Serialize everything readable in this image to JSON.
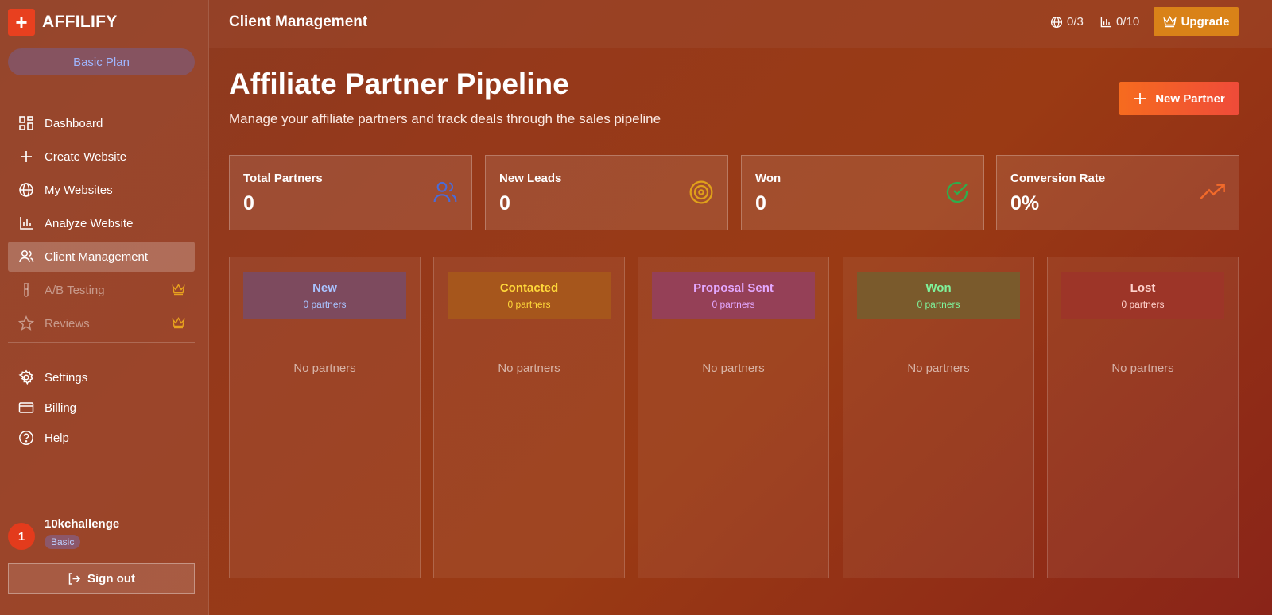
{
  "app": {
    "logo_glyph": "+",
    "name": "AFFILIFY",
    "plan_pill": "Basic Plan"
  },
  "sidebar": {
    "items": [
      {
        "label": "Dashboard",
        "icon": "grid-icon"
      },
      {
        "label": "Create Website",
        "icon": "plus-icon"
      },
      {
        "label": "My Websites",
        "icon": "globe-icon"
      },
      {
        "label": "Analyze Website",
        "icon": "bar-chart-icon"
      },
      {
        "label": "Client Management",
        "icon": "users-icon",
        "active": true
      },
      {
        "label": "A/B Testing",
        "icon": "test-tube-icon",
        "locked": true
      },
      {
        "label": "Reviews",
        "icon": "star-icon",
        "locked": true
      }
    ],
    "footer_items": [
      {
        "label": "Settings",
        "icon": "gear-icon"
      },
      {
        "label": "Billing",
        "icon": "credit-card-icon"
      },
      {
        "label": "Help",
        "icon": "help-circle-icon"
      }
    ]
  },
  "user": {
    "avatar_initial": "1",
    "name": "10kchallenge",
    "plan": "Basic",
    "signout_label": "Sign out"
  },
  "topbar": {
    "title": "Client Management",
    "websites_usage": "0/3",
    "analyses_usage": "0/10",
    "upgrade_label": "Upgrade"
  },
  "main": {
    "title": "Affiliate Partner Pipeline",
    "subtitle": "Manage your affiliate partners and track deals through the sales pipeline",
    "new_partner_label": "New Partner",
    "stats": [
      {
        "label": "Total Partners",
        "value": "0",
        "icon": "users-icon",
        "color": "#4a6bd8"
      },
      {
        "label": "New Leads",
        "value": "0",
        "icon": "target-icon",
        "color": "#e0a11a"
      },
      {
        "label": "Won",
        "value": "0",
        "icon": "check-circle-icon",
        "color": "#2fae4c"
      },
      {
        "label": "Conversion Rate",
        "value": "0%",
        "icon": "trending-up-icon",
        "color": "#f26a2a"
      }
    ],
    "columns": [
      {
        "name": "New",
        "count": "0 partners",
        "empty": "No partners",
        "bg": "#7d4a5e",
        "name_color": "#a9c3ff",
        "count_color": "#a9c3ff"
      },
      {
        "name": "Contacted",
        "count": "0 partners",
        "empty": "No partners",
        "bg": "#a6561c",
        "name_color": "#ffd83a",
        "count_color": "#ffd83a"
      },
      {
        "name": "Proposal Sent",
        "count": "0 partners",
        "empty": "No partners",
        "bg": "#954057",
        "name_color": "#e3a8ff",
        "count_color": "#e3a8ff"
      },
      {
        "name": "Won",
        "count": "0 partners",
        "empty": "No partners",
        "bg": "#7a5a2c",
        "name_color": "#7ff29a",
        "count_color": "#7ff29a"
      },
      {
        "name": "Lost",
        "count": "0 partners",
        "empty": "No partners",
        "bg": "#9d3528",
        "name_color": "#ffd2cc",
        "count_color": "#ffd2cc"
      }
    ]
  }
}
